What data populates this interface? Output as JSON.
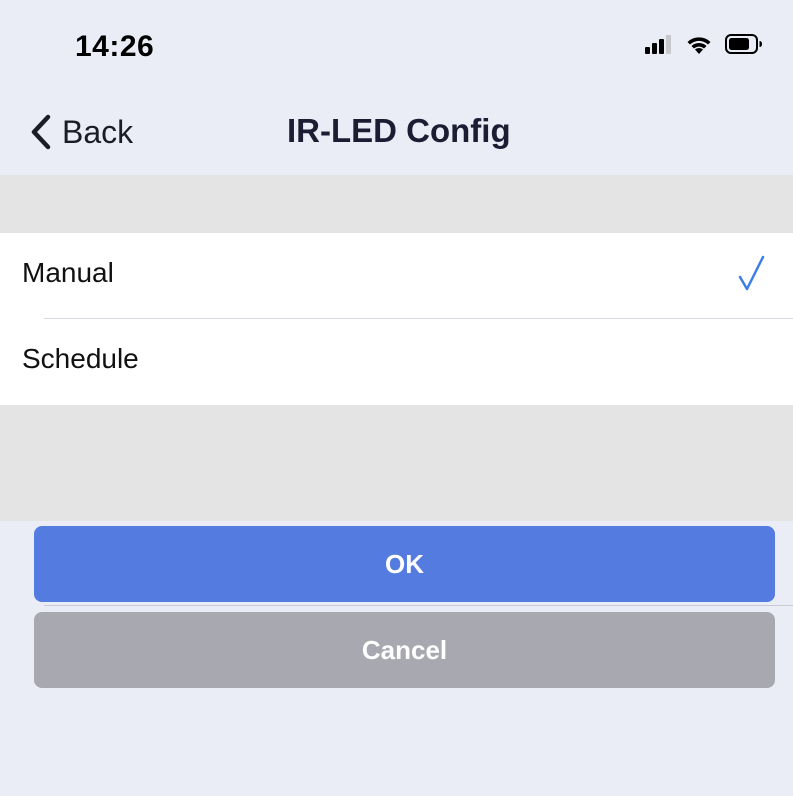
{
  "status_bar": {
    "time": "14:26",
    "icons": [
      "signal-icon",
      "wifi-icon",
      "battery-icon"
    ]
  },
  "nav": {
    "back_label": "Back",
    "title": "IR-LED Config"
  },
  "options": [
    {
      "label": "Manual",
      "selected": true
    },
    {
      "label": "Schedule",
      "selected": false
    }
  ],
  "buttons": {
    "ok_label": "OK",
    "cancel_label": "Cancel"
  },
  "colors": {
    "background": "#eaedf5",
    "section_gray": "#e4e4e4",
    "accent_blue": "#547ce0",
    "cancel_gray": "#a8a8b1",
    "checkmark": "#3d7ee6"
  }
}
